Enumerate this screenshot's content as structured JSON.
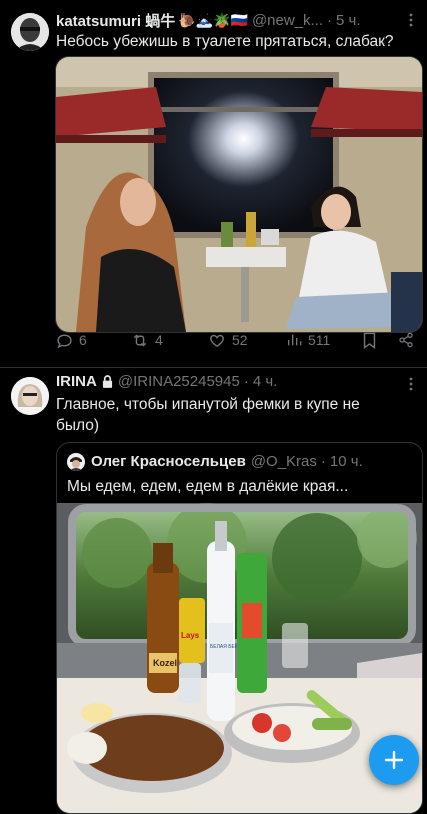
{
  "tweet1": {
    "display_name": "katatsumuri 蝸牛",
    "name_emojis": [
      "🐌",
      "🗻",
      "🪴",
      "🇷🇺"
    ],
    "handle": "@new_k...",
    "time": "5 ч.",
    "text": "Небось убежишь в туалете прятаться, слабак?",
    "stats": {
      "replies": "6",
      "retweets": "4",
      "likes": "52",
      "views": "511"
    }
  },
  "tweet2": {
    "display_name": "IRINA",
    "handle": "@IRINA25245945",
    "time": "4 ч.",
    "text": "Главное, чтобы ипанутой фемки в купе не было)",
    "quote": {
      "display_name": "Олег Красносельцев",
      "handle": "@O_Kras",
      "time": "10 ч.",
      "text": "Мы едем, едем, едем в далёкие края..."
    }
  },
  "separator": "·",
  "image_labels": {
    "bottle_brand": "БЕЛАЯ БЕРЕЗКА",
    "beer_brand": "Kozel",
    "chips_brand": "Lays"
  },
  "colors": {
    "background": "#000000",
    "text": "#e7e9ea",
    "muted": "#71767b",
    "border": "#2f3336",
    "accent": "#1d9bf0"
  },
  "icons": {
    "reply": "reply-icon",
    "retweet": "retweet-icon",
    "like": "heart-icon",
    "views": "views-icon",
    "bookmark": "bookmark-icon",
    "share": "share-icon",
    "more": "more-icon",
    "lock": "lock-icon",
    "compose": "plus-icon"
  }
}
